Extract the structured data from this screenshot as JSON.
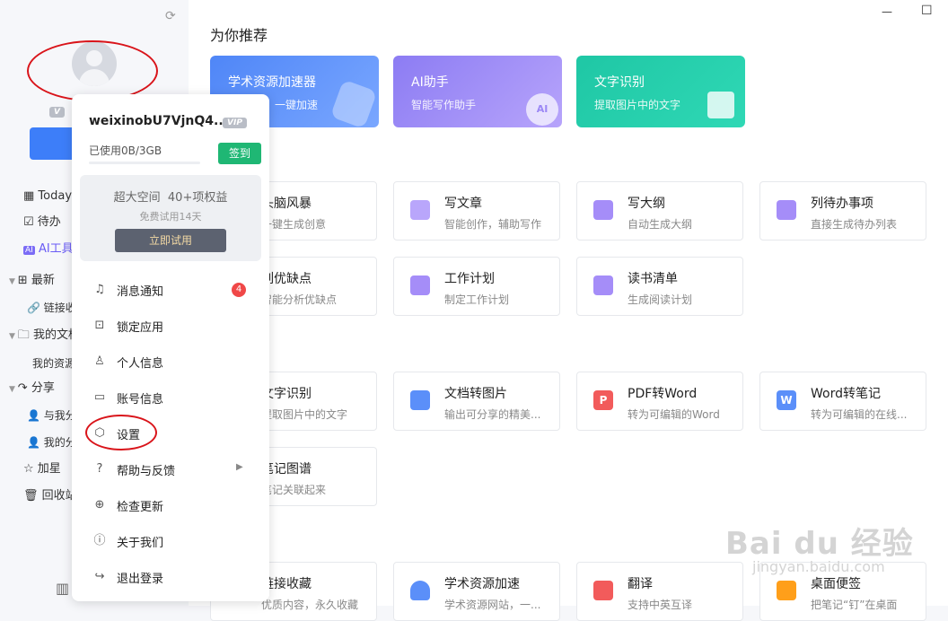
{
  "window": {
    "minimize_symbol": "—",
    "maximize_symbol": "☐"
  },
  "sidebar": {
    "items": [
      {
        "icon": "calendar-icon",
        "label": "Today"
      },
      {
        "icon": "checkbox-icon",
        "label": "待办"
      },
      {
        "icon": "ai-icon",
        "label": "AI工具"
      },
      {
        "icon": "grid-icon",
        "label": "最新"
      },
      {
        "icon": "link-icon",
        "label": "链接收藏"
      },
      {
        "icon": "folder-icon",
        "label": "我的文档"
      },
      {
        "icon": "",
        "label": "我的资源"
      },
      {
        "icon": "share-icon",
        "label": "分享"
      },
      {
        "icon": "user-icon",
        "label": "与我分享"
      },
      {
        "icon": "user-icon",
        "label": "我的分享"
      },
      {
        "icon": "star-icon",
        "label": "加星"
      },
      {
        "icon": "trash-icon",
        "label": "回收站"
      }
    ]
  },
  "main": {
    "section_title": "为你推荐",
    "featured": [
      {
        "title": "学术资源加速器",
        "subtitle": "，一键加速",
        "color": "#5b8ff9"
      },
      {
        "title": "AI助手",
        "subtitle": "智能写作助手",
        "color": "#9b87f5"
      },
      {
        "title": "文字识别",
        "subtitle": "提取图片中的文字",
        "color": "#20c9a6"
      }
    ],
    "cards_ai": [
      {
        "title": "头脑风暴",
        "subtitle": "一键生成创意",
        "color": "#ff8a3d"
      },
      {
        "title": "写文章",
        "subtitle": "智能创作，辅助写作",
        "color": "#9b7cf5"
      },
      {
        "title": "写大纲",
        "subtitle": "自动生成大纲",
        "color": "#9b7cf5"
      },
      {
        "title": "列待办事项",
        "subtitle": "直接生成待办列表",
        "color": "#9b7cf5"
      },
      {
        "title": "列优缺点",
        "subtitle": "智能分析优缺点",
        "color": "#ff8a3d"
      },
      {
        "title": "工作计划",
        "subtitle": "制定工作计划",
        "color": "#9b7cf5"
      },
      {
        "title": "读书清单",
        "subtitle": "生成阅读计划",
        "color": "#9b7cf5"
      }
    ],
    "cards_tools": [
      {
        "title": "文字识别",
        "subtitle": "提取图片中的文字",
        "color": "#20c9a6"
      },
      {
        "title": "文档转图片",
        "subtitle": "输出可分享的精美...",
        "color": "#3d7ef9"
      },
      {
        "title": "PDF转Word",
        "subtitle": "转为可编辑的Word",
        "color": "#f04848"
      },
      {
        "title": "Word转笔记",
        "subtitle": "转为可编辑的在线...",
        "color": "#3d7ef9"
      },
      {
        "title": "笔记图谱",
        "subtitle": "笔记关联起来",
        "color": "#3d7ef9"
      }
    ],
    "cards_bottom": [
      {
        "title": "链接收藏",
        "subtitle": "优质内容，永久收藏",
        "color": "#3d7ef9"
      },
      {
        "title": "学术资源加速",
        "subtitle": "学术资源网站，一...",
        "color": "#3d7ef9"
      },
      {
        "title": "翻译",
        "subtitle": "支持中英互译",
        "color": "#f04848"
      },
      {
        "title": "桌面便签",
        "subtitle": "把笔记“钉”在桌面",
        "color": "#ff9f1a"
      }
    ]
  },
  "popup": {
    "username": "weixinobU7VjnQ4...",
    "vip_badge": "VIP",
    "storage": "已使用0B/3GB",
    "checkin": "签到",
    "promo": {
      "line1": "超大空间  40+项权益",
      "line2": "免费试用14天",
      "button": "立即试用"
    },
    "menu": [
      {
        "icon": "bell-icon",
        "glyph": "🔔",
        "label": "消息通知",
        "badge": "4"
      },
      {
        "icon": "lock-icon",
        "glyph": "🔒",
        "label": "锁定应用"
      },
      {
        "icon": "person-icon",
        "glyph": "👤",
        "label": "个人信息"
      },
      {
        "icon": "monitor-icon",
        "glyph": "▭",
        "label": "账号信息"
      },
      {
        "icon": "settings-icon",
        "glyph": "⬡",
        "label": "设置"
      },
      {
        "icon": "help-icon",
        "glyph": "?",
        "label": "帮助与反馈"
      },
      {
        "icon": "update-icon",
        "glyph": "↑",
        "label": "检查更新"
      },
      {
        "icon": "info-icon",
        "glyph": "i",
        "label": "关于我们"
      },
      {
        "icon": "logout-icon",
        "glyph": "↪",
        "label": "退出登录"
      }
    ]
  },
  "watermark": {
    "brand": "Bai du 经验",
    "url": "jingyan.baidu.com"
  }
}
